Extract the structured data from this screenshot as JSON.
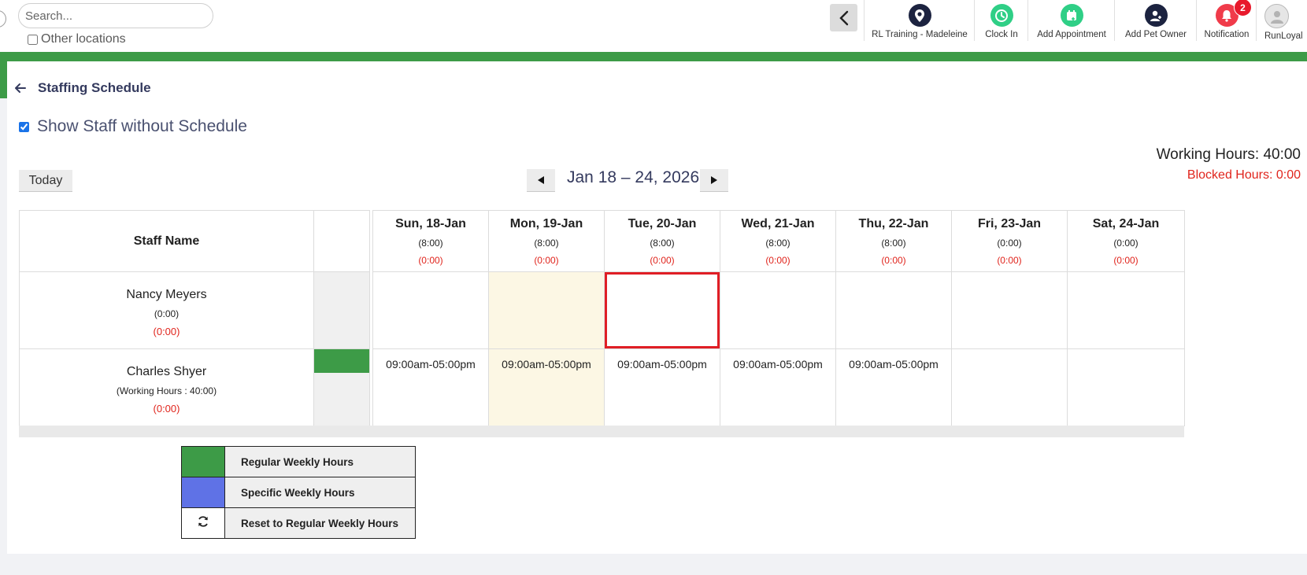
{
  "header": {
    "search": {
      "placeholder": "Search..."
    },
    "other_locations_label": "Other locations",
    "actions": [
      {
        "label": "RL Training - Madeleine",
        "icon": "location-pin-icon",
        "color": "#1c2340"
      },
      {
        "label": "Clock In",
        "icon": "clock-icon",
        "color": "#2fcf86"
      },
      {
        "label": "Add Appointment",
        "icon": "calendar-add-icon",
        "color": "#2fcf86"
      },
      {
        "label": "Add Pet Owner",
        "icon": "add-user-icon",
        "color": "#1c2340"
      },
      {
        "label": "Notification",
        "icon": "bell-icon",
        "color": "#f03b4a",
        "badge": "2"
      },
      {
        "label": "RunLoyal",
        "icon": "avatar-icon",
        "color": "#9a9a9a"
      }
    ]
  },
  "page": {
    "title": "Staffing Schedule",
    "show_staff_label": "Show Staff without Schedule",
    "show_staff_checked": true,
    "working_hours_total": "Working Hours: 40:00",
    "blocked_hours_total": "Blocked Hours: 0:00"
  },
  "toolbar": {
    "today_label": "Today",
    "week_range": "Jan 18 – 24, 2026"
  },
  "schedule": {
    "staff_header": "Staff Name",
    "days": [
      {
        "label": "Sun, 18-Jan",
        "hours": "(8:00)",
        "blocked": "(0:00)"
      },
      {
        "label": "Mon, 19-Jan",
        "hours": "(8:00)",
        "blocked": "(0:00)"
      },
      {
        "label": "Tue, 20-Jan",
        "hours": "(8:00)",
        "blocked": "(0:00)"
      },
      {
        "label": "Wed, 21-Jan",
        "hours": "(8:00)",
        "blocked": "(0:00)"
      },
      {
        "label": "Thu, 22-Jan",
        "hours": "(8:00)",
        "blocked": "(0:00)"
      },
      {
        "label": "Fri, 23-Jan",
        "hours": "(0:00)",
        "blocked": "(0:00)"
      },
      {
        "label": "Sat, 24-Jan",
        "hours": "(0:00)",
        "blocked": "(0:00)"
      }
    ],
    "staff": [
      {
        "name": "Nancy Meyers",
        "hours": "(0:00)",
        "blocked": "(0:00)",
        "shifts": [
          "",
          "",
          "",
          "",
          "",
          "",
          ""
        ]
      },
      {
        "name": "Charles Shyer",
        "hours": "(Working Hours : 40:00)",
        "blocked": "(0:00)",
        "shifts": [
          "09:00am-05:00pm",
          "09:00am-05:00pm",
          "09:00am-05:00pm",
          "09:00am-05:00pm",
          "09:00am-05:00pm",
          "",
          ""
        ]
      }
    ]
  },
  "legend": [
    {
      "label": "Regular Weekly Hours",
      "color": "#3d9b47"
    },
    {
      "label": "Specific Weekly Hours",
      "color": "#5f72e6"
    },
    {
      "label": "Reset to Regular Weekly Hours",
      "icon": "refresh-icon"
    }
  ]
}
